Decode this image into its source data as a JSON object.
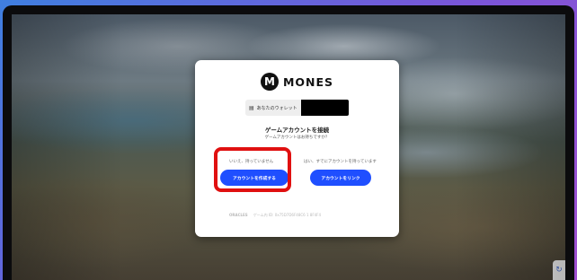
{
  "brand": {
    "icon_letter": "M",
    "name": "MONES"
  },
  "wallet": {
    "label": "あなたのウォレット",
    "icon": "wallet-icon",
    "value": ""
  },
  "heading": "ゲームアカウントを接続",
  "subheading": "ゲームアカウントはお持ちですか？",
  "options": {
    "create": {
      "question": "いいえ、持っていません",
      "button_label": "アカウントを作成する"
    },
    "link": {
      "question": "はい、すでにアカウントを持っています",
      "button_label": "アカウントをリンク"
    }
  },
  "footer": {
    "logo_text": "ORACLES",
    "text": "ゲーム内 ID: 0x75D7D6F48C6 1 8F4F4"
  },
  "colors": {
    "accent": "#1f4fff",
    "highlight": "#e01010"
  },
  "corner_badge_icon": "recaptcha-icon"
}
